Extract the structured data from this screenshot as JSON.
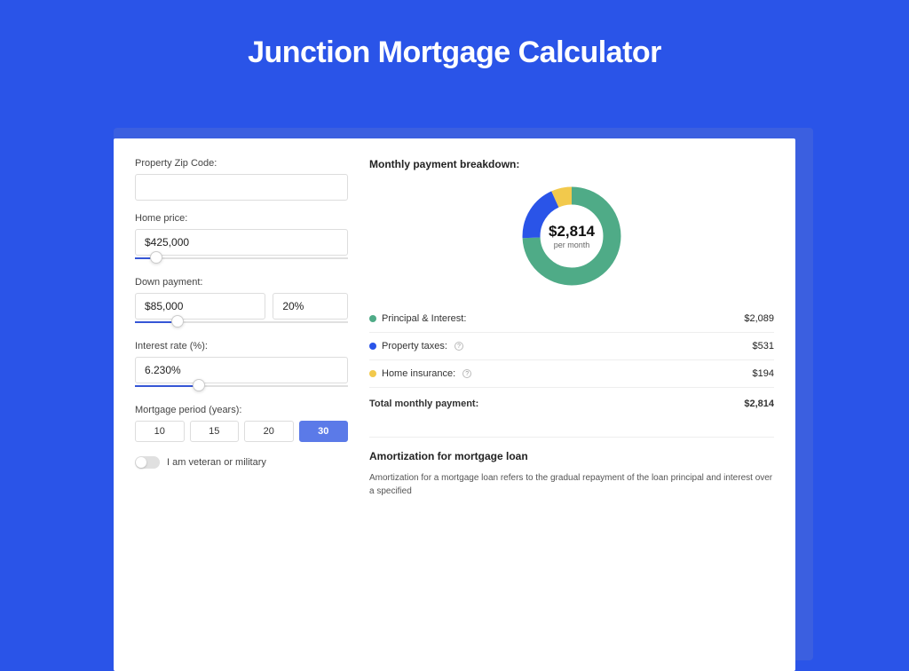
{
  "page": {
    "title": "Junction Mortgage Calculator"
  },
  "form": {
    "zip_label": "Property Zip Code:",
    "zip_value": "",
    "home_price_label": "Home price:",
    "home_price_value": "$425,000",
    "down_payment_label": "Down payment:",
    "down_payment_value": "$85,000",
    "down_payment_pct": "20%",
    "interest_label": "Interest rate (%):",
    "interest_value": "6.230%",
    "period_label": "Mortgage period (years):",
    "period_options": [
      "10",
      "15",
      "20",
      "30"
    ],
    "period_selected": "30",
    "veteran_label": "I am veteran or military"
  },
  "breakdown": {
    "title": "Monthly payment breakdown:",
    "center_amount": "$2,814",
    "center_sub": "per month",
    "items": [
      {
        "label": "Principal & Interest:",
        "value": "$2,089",
        "color": "#4fab87",
        "info": false
      },
      {
        "label": "Property taxes:",
        "value": "$531",
        "color": "#2a54e8",
        "info": true
      },
      {
        "label": "Home insurance:",
        "value": "$194",
        "color": "#f2c94c",
        "info": true
      }
    ],
    "total_label": "Total monthly payment:",
    "total_value": "$2,814"
  },
  "amort": {
    "title": "Amortization for mortgage loan",
    "body": "Amortization for a mortgage loan refers to the gradual repayment of the loan principal and interest over a specified"
  },
  "chart_data": {
    "type": "pie",
    "title": "Monthly payment breakdown",
    "series": [
      {
        "name": "Principal & Interest",
        "value": 2089,
        "color": "#4fab87"
      },
      {
        "name": "Property taxes",
        "value": 531,
        "color": "#2a54e8"
      },
      {
        "name": "Home insurance",
        "value": 194,
        "color": "#f2c94c"
      }
    ],
    "total": 2814,
    "center_label": "$2,814 per month"
  },
  "colors": {
    "accent": "#2a54e8",
    "green": "#4fab87",
    "yellow": "#f2c94c"
  }
}
